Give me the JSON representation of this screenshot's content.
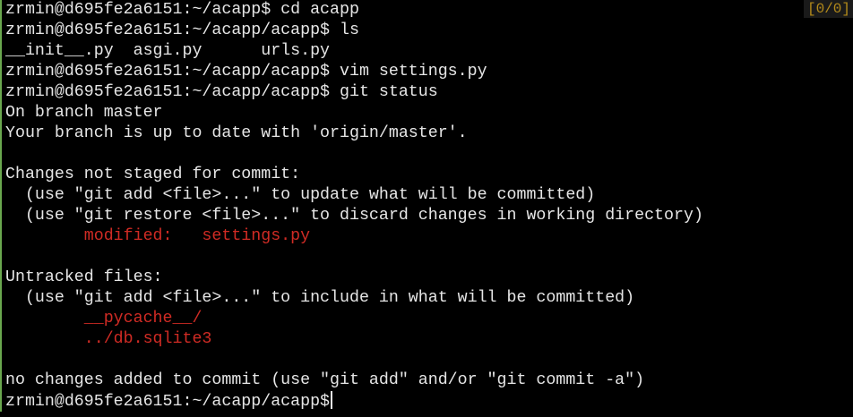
{
  "terminal": {
    "pane_indicator": "[0/0]",
    "colors": {
      "background": "#000000",
      "text": "#e6e6e6",
      "modified": "#d02b24",
      "untracked": "#d02b24",
      "gutter": "#6aa84f",
      "indicator": "#b38a1a"
    },
    "lines": [
      "zrmin@d695fe2a6151:~/acapp$ cd acapp",
      "zrmin@d695fe2a6151:~/acapp/acapp$ ls",
      "__init__.py  asgi.py      urls.py",
      "zrmin@d695fe2a6151:~/acapp/acapp$ vim settings.py",
      "zrmin@d695fe2a6151:~/acapp/acapp$ git status",
      "On branch master",
      "Your branch is up to date with 'origin/master'.",
      "",
      "Changes not staged for commit:",
      "  (use \"git add <file>...\" to update what will be committed)",
      "  (use \"git restore <file>...\" to discard changes in working directory)",
      "        modified:   settings.py",
      "",
      "Untracked files:",
      "  (use \"git add <file>...\" to include in what will be committed)",
      "        __pycache__/",
      "        ../db.sqlite3",
      "",
      "no changes added to commit (use \"git add\" and/or \"git commit -a\")",
      "zrmin@d695fe2a6151:~/acapp/acapp$"
    ]
  }
}
